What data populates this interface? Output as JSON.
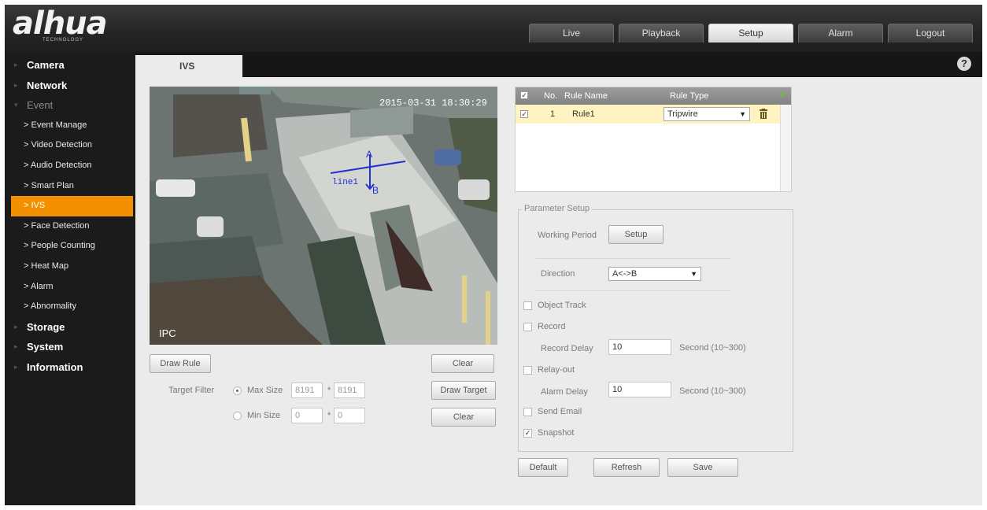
{
  "brand": {
    "logo": "alhua",
    "sub": "TECHNOLOGY"
  },
  "nav_tabs": [
    "Live",
    "Playback",
    "Setup",
    "Alarm",
    "Logout"
  ],
  "nav_active": "Setup",
  "sidebar": {
    "camera": "Camera",
    "network": "Network",
    "event": "Event",
    "event_items": [
      "> Event Manage",
      "> Video Detection",
      "> Audio Detection",
      "> Smart Plan",
      "> IVS",
      "> Face Detection",
      "> People Counting",
      "> Heat Map",
      "> Alarm",
      "> Abnormality"
    ],
    "active_item": "> IVS",
    "storage": "Storage",
    "system": "System",
    "information": "Information"
  },
  "content": {
    "tab": "IVS",
    "help": "?"
  },
  "video": {
    "timestamp": "2015-03-31 18:30:29",
    "osd": "IPC",
    "rule_label": "line1",
    "point_a": "A",
    "point_b": "B"
  },
  "left_controls": {
    "draw_rule": "Draw Rule",
    "clear_1": "Clear",
    "target_filter": "Target Filter",
    "max_size": "Max Size",
    "max_w": "8191",
    "max_h": "8191",
    "min_size": "Min Size",
    "min_w": "0",
    "min_h": "0",
    "times": "*",
    "draw_target": "Draw Target",
    "clear_2": "Clear"
  },
  "rules_table": {
    "header": {
      "no": "No.",
      "name": "Rule Name",
      "type": "Rule Type"
    },
    "rows": [
      {
        "no": "1",
        "name": "Rule1",
        "type": "Tripwire",
        "checked": true
      }
    ]
  },
  "param": {
    "title": "Parameter Setup",
    "working_period": "Working Period",
    "setup_btn": "Setup",
    "direction": "Direction",
    "direction_value": "A<->B",
    "object_track": "Object Track",
    "record": "Record",
    "record_delay": "Record Delay",
    "record_delay_value": "10",
    "record_delay_unit": "Second (10~300)",
    "relay_out": "Relay-out",
    "alarm_delay": "Alarm Delay",
    "alarm_delay_value": "10",
    "alarm_delay_unit": "Second (10~300)",
    "send_email": "Send Email",
    "snapshot": "Snapshot",
    "checkbox_states": {
      "object_track": false,
      "record": false,
      "relay_out": false,
      "send_email": false,
      "snapshot": true
    }
  },
  "footer": {
    "default": "Default",
    "refresh": "Refresh",
    "save": "Save"
  },
  "colors": {
    "accent": "#f39000",
    "header_bg": "#2b2b2b",
    "panel_bg": "#ebebeb",
    "rule_row": "#fff3c2"
  }
}
